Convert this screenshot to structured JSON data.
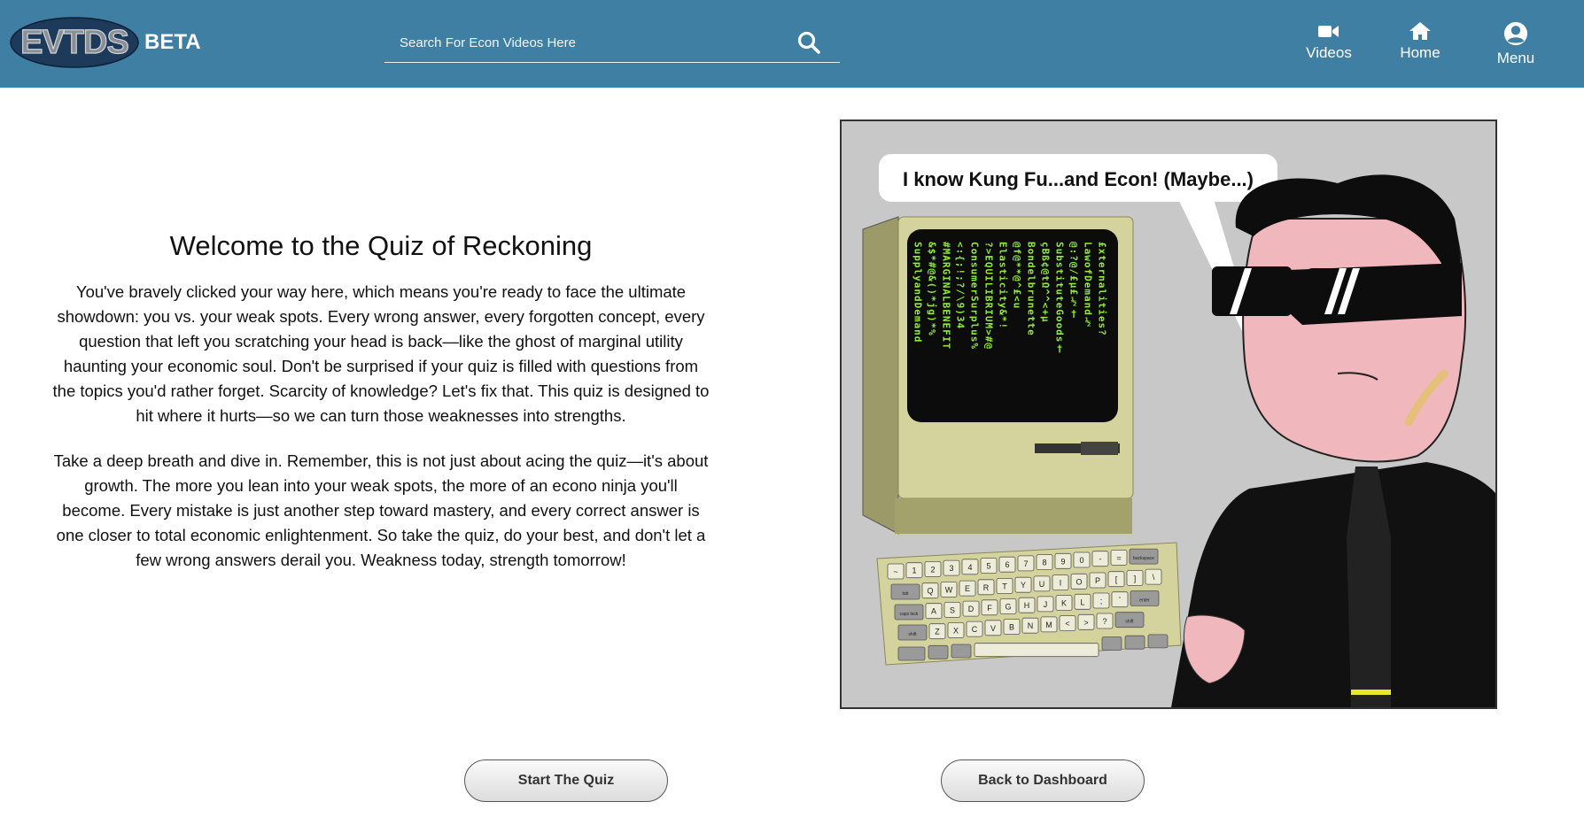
{
  "header": {
    "logo_text": "EVTDS",
    "beta_label": "BETA",
    "search": {
      "placeholder": "Search For Econ Videos Here",
      "value": ""
    },
    "nav": [
      {
        "label": "Videos",
        "icon": "video-camera-icon"
      },
      {
        "label": "Home",
        "icon": "home-icon"
      },
      {
        "label": "Menu",
        "icon": "user-circle-icon"
      }
    ]
  },
  "main": {
    "title": "Welcome to the Quiz of Reckoning",
    "paragraphs": [
      "You've bravely clicked your way here, which means you're ready to face the ultimate showdown: you vs. your weak spots. Every wrong answer, every forgotten concept, every question that left you scratching your head is back—like the ghost of marginal utility haunting your economic soul. Don't be surprised if your quiz is filled with questions from the topics you'd rather forget. Scarcity of knowledge? Let's fix that. This quiz is designed to hit where it hurts—so we can turn those weaknesses into strengths.",
      "Take a deep breath and dive in. Remember, this is not just about acing the quiz—it's about growth. The more you lean into your weak spots, the more of an econo ninja you'll become. Every mistake is just another step toward mastery, and every correct answer is one closer to total economic enlightenment. So take the quiz, do your best, and don't let a few wrong answers derail you. Weakness today, strength tomorrow!"
    ],
    "comic": {
      "speech": "I know Kung Fu...and Econ! (Maybe...)",
      "screen_columns": [
        "SupplyandDemand",
        "&$*#@&()*jg)*%",
        "#MARGINALBENEFIT",
        "<:{;!;?/\\9)34",
        "ConsumerSurplus%",
        "?>EQUILIBRIUM>#@",
        "Elasticity&*!",
        "@f@**@^£<u",
        "Bondelbrunette",
        "çBß¢@tΩ^^<+μ",
        "SubstituteGoods†",
        "@:?@/£μ£½†",
        "LawofDemand½",
        "£xternalities?"
      ],
      "keyboard_rows": [
        [
          "~",
          "1",
          "2",
          "3",
          "4",
          "5",
          "6",
          "7",
          "8",
          "9",
          "0",
          "-",
          "=",
          "backspace"
        ],
        [
          "tab",
          "Q",
          "W",
          "E",
          "R",
          "T",
          "Y",
          "U",
          "I",
          "O",
          "P",
          "[",
          "]",
          "\\"
        ],
        [
          "caps lock",
          "A",
          "S",
          "D",
          "F",
          "G",
          "H",
          "J",
          "K",
          "L",
          ";",
          "'",
          "enter"
        ],
        [
          "shift",
          "Z",
          "X",
          "C",
          "V",
          "B",
          "N",
          "M",
          "<",
          ">",
          "?",
          "shift"
        ]
      ]
    }
  },
  "actions": {
    "start_label": "Start The Quiz",
    "dashboard_label": "Back to Dashboard"
  },
  "colors": {
    "header_bg": "#3e7fa3",
    "logo_bg": "#1d3a5a",
    "screen_text": "#8ff02c"
  }
}
